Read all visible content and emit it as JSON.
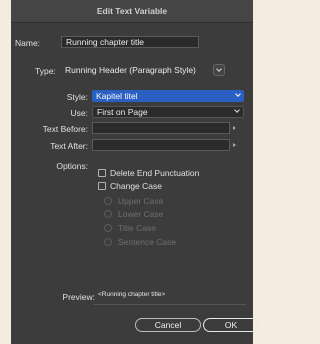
{
  "dialog": {
    "title": "Edit Text Variable"
  },
  "name": {
    "label": "Name:",
    "value": "Running chapter title"
  },
  "type": {
    "label": "Type:",
    "value": "Running Header (Paragraph Style)"
  },
  "style": {
    "label": "Style:",
    "value": "Kapitel titel"
  },
  "use": {
    "label": "Use:",
    "value": "First on Page"
  },
  "text_before": {
    "label": "Text Before:",
    "value": ""
  },
  "text_after": {
    "label": "Text After:",
    "value": ""
  },
  "options": {
    "label": "Options:",
    "delete_end_punctuation": "Delete End Punctuation",
    "change_case": "Change Case",
    "upper_case": "Upper Case",
    "lower_case": "Lower Case",
    "title_case": "Title Case",
    "sentence_case": "Sentence Case"
  },
  "preview": {
    "label": "Preview:",
    "value": "<Running chapter title>"
  },
  "buttons": {
    "cancel": "Cancel",
    "ok": "OK"
  },
  "colors": {
    "background": "#3c3c3c",
    "accent": "#2a5fc4",
    "field": "#2b2b2b"
  }
}
